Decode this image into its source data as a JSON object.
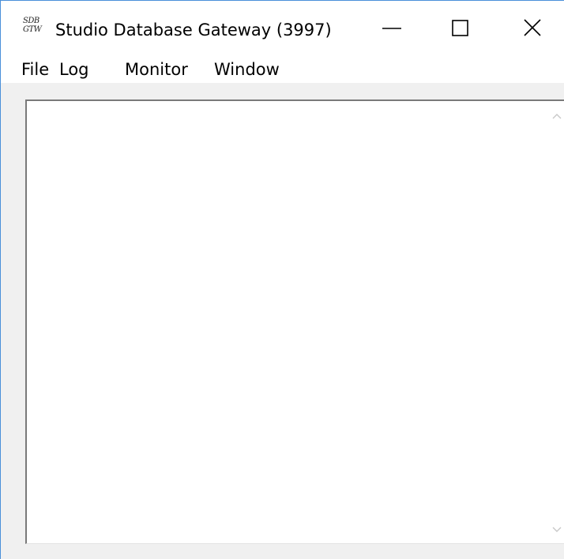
{
  "window": {
    "title": "Studio Database Gateway (3997)",
    "icon_lines": [
      "SDB",
      "GTW"
    ]
  },
  "menu": {
    "items": [
      "File",
      "Log",
      "Monitor",
      "Window"
    ]
  },
  "colors": {
    "titlebar": "#ffffff",
    "client": "#f0f0f0",
    "pane": "#ffffff",
    "border": "#7a7a7a"
  },
  "icons": {
    "minimize": "minimize-icon",
    "maximize": "maximize-icon",
    "close": "close-icon",
    "scroll_up": "chevron-up-icon",
    "scroll_down": "chevron-down-icon"
  }
}
